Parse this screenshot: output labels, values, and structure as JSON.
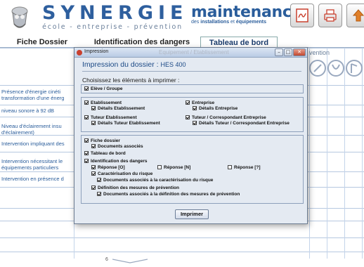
{
  "header": {
    "brand_name": "SYNERGIE",
    "brand_tagline": "école - entreprise - prévention",
    "maintenance_title": "maintenance",
    "maintenance_sub_prefix": "des",
    "maintenance_sub_bold1": "installations",
    "maintenance_sub_mid": "et",
    "maintenance_sub_bold2": "équipements",
    "buttons": [
      "pdf-icon",
      "printer-icon",
      "upload-icon"
    ]
  },
  "tabs": [
    {
      "label": "Fiche Dossier"
    },
    {
      "label": "Identification des dangers"
    },
    {
      "label": "Tableau de bord"
    }
  ],
  "background": {
    "right_text": "vention",
    "rows": [
      "Présence d'énergie cinéti",
      "transformation d'une énerg",
      "niveau sonore à 92 dB",
      "Niveau d'éclairement insu",
      "d'éclairement)",
      "Intervention impliquant des",
      "Intervention nécessitant le",
      "équipements particuliers",
      "Intervention en présence d"
    ],
    "page_number": "6"
  },
  "dialog": {
    "window_title": "Impression",
    "ghost_title": "Equipement / Etablissement",
    "heading": "Impression du dossier :",
    "dossier": "HES 400",
    "choose_label": "Choisissez les éléments à imprimer :",
    "options": {
      "eleve_groupe": "Elève / Groupe",
      "etablissement": "Etablissement",
      "details_etablissement": "Détails Etablissement",
      "entreprise": "Entreprise",
      "details_entreprise": "Détails Entreprise",
      "tuteur_etablissement": "Tuteur Etablissement",
      "details_tuteur_etablissement": "Détails Tuteur Etablissement",
      "tuteur_correspondant": "Tuteur / Correspondant Entreprise",
      "details_tuteur_correspondant": "Détails Tuteur / Correspondant Entreprise",
      "fiche_dossier": "Fiche dossier",
      "documents_associes": "Documents associés",
      "tableau_de_bord": "Tableau de bord",
      "identification_dangers": "Identification des dangers",
      "reponse_o": "Réponse [O]",
      "reponse_n": "Réponse [N]",
      "reponse_q": "Réponse [?]",
      "caracterisation_risque": "Caractérisation du risque",
      "docs_caracterisation": "Documents associés à la caractérisation du risque",
      "definition_mesures": "Définition des mesures de prévention",
      "docs_definition": "Documents associés à la définition des mesures de prévention"
    },
    "print_button": "Imprimer"
  }
}
